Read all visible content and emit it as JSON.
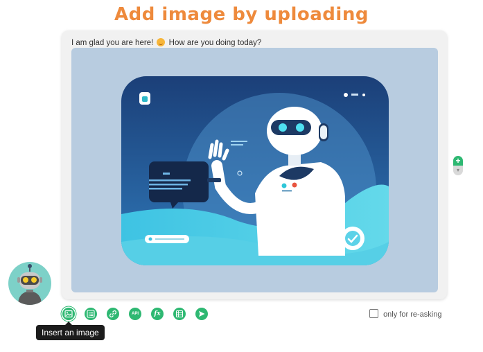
{
  "header": {
    "title": "Add image by uploading"
  },
  "chat": {
    "message_before": "I am glad you are here!",
    "message_after": "How are you doing today?",
    "emoji_icon": "smiling-face-emoji"
  },
  "image": {
    "alt": "Robot assistant waving illustration"
  },
  "toolbar": {
    "buttons": [
      {
        "name": "insert-image",
        "icon": "image-icon"
      },
      {
        "name": "list",
        "icon": "list-icon"
      },
      {
        "name": "link",
        "icon": "link-icon"
      },
      {
        "name": "api",
        "icon": "api-icon",
        "label": "API"
      },
      {
        "name": "function",
        "icon": "function-icon",
        "label": "fx"
      },
      {
        "name": "table",
        "icon": "table-icon"
      },
      {
        "name": "send",
        "icon": "send-icon"
      }
    ],
    "tooltip": "Insert an image"
  },
  "options": {
    "reask_label": "only for re-asking",
    "reask_checked": false
  },
  "scroll": {
    "up_label": "+",
    "down_label": "▾"
  },
  "colors": {
    "accent": "#2eb872",
    "title": "#ee8a3c",
    "tooltip_bg": "#1c1c1c"
  }
}
